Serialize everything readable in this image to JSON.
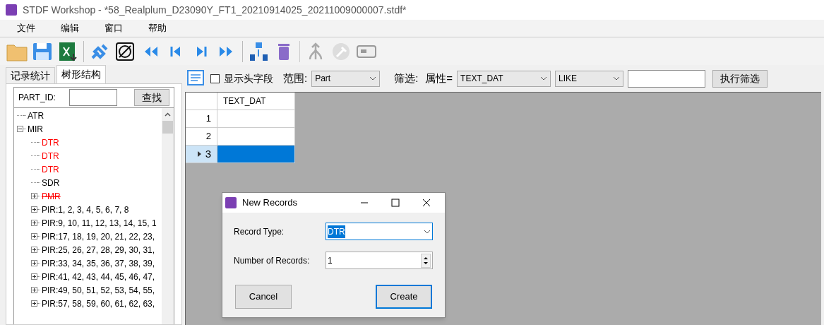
{
  "window": {
    "title": "STDF Workshop - *58_Realplum_D23090Y_FT1_20210914025_20211009000007.stdf*"
  },
  "menu": [
    "文件",
    "编辑",
    "窗口",
    "帮助"
  ],
  "left_panel": {
    "tabs": [
      {
        "label": "记录统计",
        "selected": false
      },
      {
        "label": "树形结构",
        "selected": true
      }
    ],
    "search": {
      "label": "PART_ID:",
      "button": "查找"
    },
    "tree": [
      {
        "label": "ATR",
        "kind": "leaf",
        "color": "#000000",
        "strikethrough": false
      },
      {
        "label": "MIR",
        "kind": "group",
        "expanded": true,
        "color": "#000000",
        "strikethrough": false,
        "children": [
          {
            "label": "DTR",
            "kind": "leaf",
            "color": "#ff0000",
            "strikethrough": false
          },
          {
            "label": "DTR",
            "kind": "leaf",
            "color": "#ff0000",
            "strikethrough": false
          },
          {
            "label": "DTR",
            "kind": "leaf",
            "color": "#ff0000",
            "strikethrough": false
          },
          {
            "label": "SDR",
            "kind": "leaf",
            "color": "#000000",
            "strikethrough": false
          },
          {
            "label": "PMR",
            "kind": "group",
            "expanded": false,
            "color": "#ff0000",
            "strikethrough": true
          },
          {
            "label": "PIR:1, 2, 3, 4, 5, 6, 7, 8",
            "kind": "group",
            "expanded": false,
            "color": "#000000",
            "strikethrough": false
          },
          {
            "label": "PIR:9, 10, 11, 12, 13, 14, 15, 1",
            "kind": "group",
            "expanded": false,
            "color": "#000000",
            "strikethrough": false
          },
          {
            "label": "PIR:17, 18, 19, 20, 21, 22, 23,",
            "kind": "group",
            "expanded": false,
            "color": "#000000",
            "strikethrough": false
          },
          {
            "label": "PIR:25, 26, 27, 28, 29, 30, 31,",
            "kind": "group",
            "expanded": false,
            "color": "#000000",
            "strikethrough": false
          },
          {
            "label": "PIR:33, 34, 35, 36, 37, 38, 39,",
            "kind": "group",
            "expanded": false,
            "color": "#000000",
            "strikethrough": false
          },
          {
            "label": "PIR:41, 42, 43, 44, 45, 46, 47,",
            "kind": "group",
            "expanded": false,
            "color": "#000000",
            "strikethrough": false
          },
          {
            "label": "PIR:49, 50, 51, 52, 53, 54, 55,",
            "kind": "group",
            "expanded": false,
            "color": "#000000",
            "strikethrough": false
          },
          {
            "label": "PIR:57, 58, 59, 60, 61, 62, 63,",
            "kind": "group",
            "expanded": false,
            "color": "#000000",
            "strikethrough": false
          }
        ]
      }
    ]
  },
  "filter_bar": {
    "show_header": {
      "label": "显示头字段",
      "checked": false
    },
    "scope_label": "范围:",
    "scope": "Part",
    "filter_label": "筛选:",
    "attr_label": "属性=",
    "attribute": "TEXT_DAT",
    "operator": "LIKE",
    "button": "执行筛选"
  },
  "table": {
    "columns": [
      "TEXT_DAT"
    ],
    "rows": [
      {
        "number": "1",
        "value": "",
        "selected": false
      },
      {
        "number": "2",
        "value": "",
        "selected": false
      },
      {
        "number": "3",
        "value": "",
        "selected": true
      }
    ]
  },
  "dialog": {
    "title": "New Records",
    "record_type_label": "Record Type:",
    "record_type": "DTR",
    "count_label": "Number of Records:",
    "count": "1",
    "buttons": [
      "Cancel",
      "Create"
    ]
  }
}
